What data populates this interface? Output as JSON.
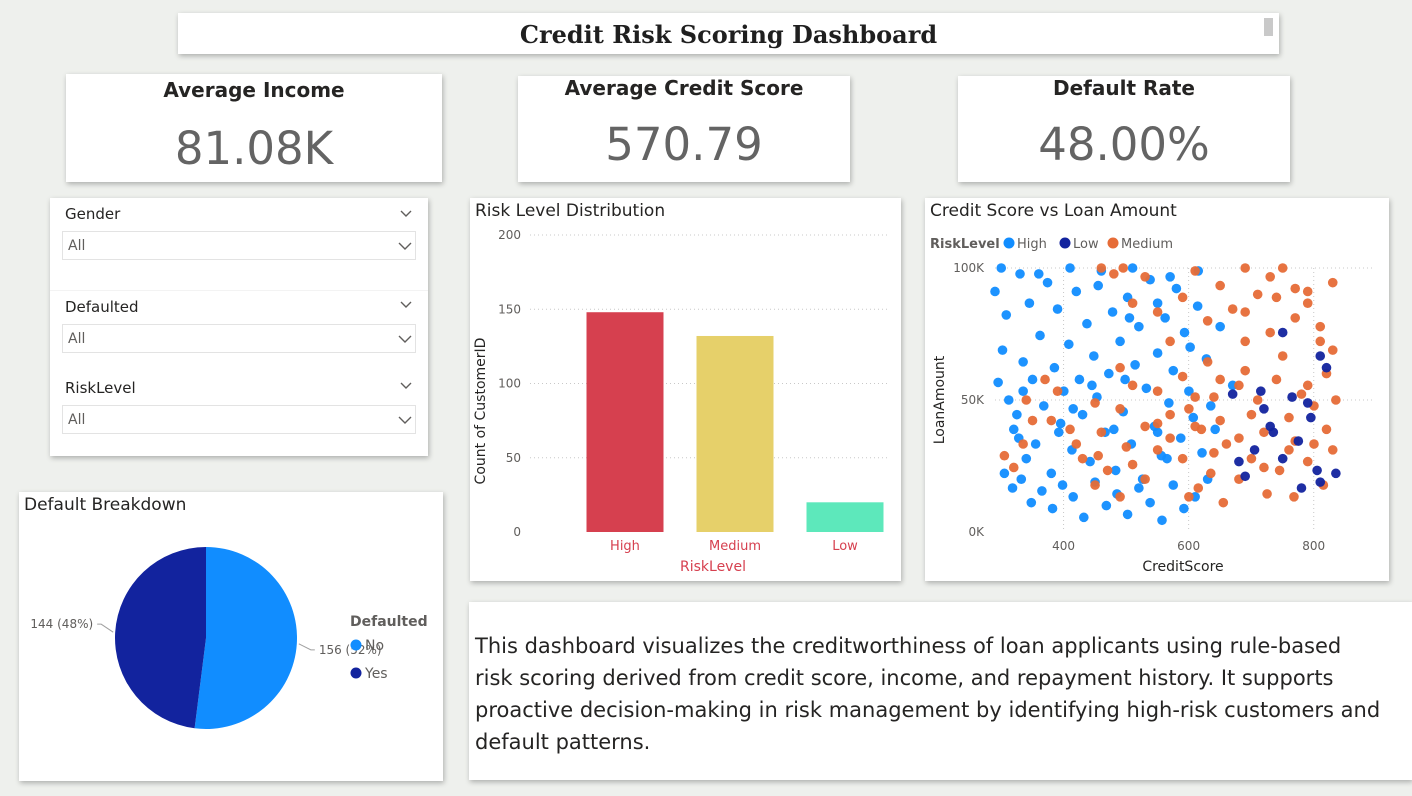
{
  "header": {
    "title": "Credit Risk Scoring Dashboard"
  },
  "kpis": {
    "income": {
      "label": "Average Income",
      "value": "81.08K"
    },
    "credit": {
      "label": "Average Credit Score",
      "value": "570.79"
    },
    "default": {
      "label": "Default Rate",
      "value": "48.00%"
    }
  },
  "slicers": [
    {
      "title": "Gender",
      "value": "All"
    },
    {
      "title": "Defaulted",
      "value": "All"
    },
    {
      "title": "RiskLevel",
      "value": "All"
    }
  ],
  "chart_data": [
    {
      "type": "bar",
      "title": "Risk Level Distribution",
      "xlabel": "RiskLevel",
      "ylabel": "Count of CustomerID",
      "categories": [
        "High",
        "Medium",
        "Low"
      ],
      "values": [
        148,
        132,
        20
      ],
      "colors": [
        "#d6404f",
        "#e6d06a",
        "#5de8bb"
      ],
      "ylim": [
        0,
        200
      ],
      "yticks": [
        0,
        50,
        100,
        150,
        200
      ],
      "grid": true
    },
    {
      "type": "scatter",
      "title": "Credit Score vs Loan Amount",
      "xlabel": "CreditScore",
      "ylabel": "LoanAmount",
      "legend_title": "RiskLevel",
      "legend_position": "top-left",
      "xlim": [
        300,
        850
      ],
      "ylim": [
        10000,
        100000
      ],
      "xticks": [
        400,
        600,
        800
      ],
      "ytick_values": [
        10000,
        55000,
        100000
      ],
      "ytick_labels": [
        "0K",
        "50K",
        "100K"
      ],
      "series": [
        {
          "name": "High",
          "color": "#118dff",
          "points": [
            [
              300,
              92000
            ],
            [
              305,
              61000
            ],
            [
              312,
              72000
            ],
            [
              318,
              84000
            ],
            [
              322,
              55000
            ],
            [
              330,
              45000
            ],
            [
              335,
              50000
            ],
            [
              340,
              98000
            ],
            [
              345,
              68000
            ],
            [
              350,
              35000
            ],
            [
              355,
              88000
            ],
            [
              360,
              62000
            ],
            [
              365,
              40000
            ],
            [
              372,
              77000
            ],
            [
              378,
              53000
            ],
            [
              384,
              95000
            ],
            [
              390,
              30000
            ],
            [
              395,
              66000
            ],
            [
              400,
              86000
            ],
            [
              405,
              47000
            ],
            [
              410,
              58000
            ],
            [
              418,
              74000
            ],
            [
              423,
              38000
            ],
            [
              430,
              92000
            ],
            [
              435,
              62000
            ],
            [
              440,
              50000
            ],
            [
              447,
              81000
            ],
            [
              452,
              34000
            ],
            [
              458,
              70000
            ],
            [
              463,
              56000
            ],
            [
              470,
              99000
            ],
            [
              476,
              44000
            ],
            [
              482,
              64000
            ],
            [
              488,
              85000
            ],
            [
              493,
              31000
            ],
            [
              500,
              75000
            ],
            [
              505,
              51000
            ],
            [
              512,
              90000
            ],
            [
              518,
              40000
            ],
            [
              524,
              67000
            ],
            [
              530,
              80000
            ],
            [
              536,
              28000
            ],
            [
              542,
              59000
            ],
            [
              548,
              96000
            ],
            [
              555,
              46000
            ],
            [
              560,
              71000
            ],
            [
              566,
              36000
            ],
            [
              572,
              83000
            ],
            [
              578,
              54000
            ],
            [
              585,
              65000
            ],
            [
              590,
              93000
            ],
            [
              597,
              42000
            ],
            [
              603,
              78000
            ],
            [
              610,
              58000
            ],
            [
              617,
              49000
            ],
            [
              624,
              87000
            ],
            [
              631,
              37000
            ],
            [
              638,
              69000
            ],
            [
              645,
              53000
            ],
            [
              652,
              45000
            ],
            [
              315,
              30000
            ],
            [
              328,
              25000
            ],
            [
              342,
              28000
            ],
            [
              358,
              20000
            ],
            [
              375,
              24000
            ],
            [
              392,
              18000
            ],
            [
              408,
              26000
            ],
            [
              425,
              22000
            ],
            [
              442,
              15000
            ],
            [
              460,
              27000
            ],
            [
              478,
              19000
            ],
            [
              495,
              23000
            ],
            [
              512,
              16000
            ],
            [
              530,
              25000
            ],
            [
              548,
              20000
            ],
            [
              567,
              14000
            ],
            [
              585,
              26000
            ],
            [
              602,
              18000
            ],
            [
              620,
              22000
            ],
            [
              640,
              28000
            ],
            [
              310,
              100000
            ],
            [
              370,
              98000
            ],
            [
              420,
              100000
            ],
            [
              465,
              94000
            ],
            [
              520,
              100000
            ],
            [
              580,
              97000
            ],
            [
              625,
              99000
            ],
            [
              338,
              42000
            ],
            [
              402,
              44000
            ],
            [
              455,
              60000
            ],
            [
              508,
              62000
            ],
            [
              560,
              44000
            ],
            [
              612,
              73000
            ],
            [
              660,
              80000
            ],
            [
              575,
              35000
            ],
            [
              490,
              45000
            ],
            [
              425,
              52000
            ],
            [
              345,
              58000
            ],
            [
              680,
              60000
            ],
            [
              560,
              88000
            ],
            [
              515,
              83000
            ]
          ]
        },
        {
          "name": "Low",
          "color": "#12239e",
          "points": [
            [
              680,
              57000
            ],
            [
              700,
              29000
            ],
            [
              715,
              38000
            ],
            [
              730,
              52000
            ],
            [
              745,
              44000
            ],
            [
              760,
              35000
            ],
            [
              775,
              56000
            ],
            [
              790,
              25000
            ],
            [
              805,
              49000
            ],
            [
              815,
              31000
            ],
            [
              820,
              70000
            ],
            [
              830,
              66000
            ],
            [
              845,
              30000
            ],
            [
              760,
              78000
            ],
            [
              800,
              54000
            ],
            [
              725,
              58000
            ],
            [
              690,
              34000
            ],
            [
              740,
              46000
            ],
            [
              785,
              41000
            ],
            [
              820,
              27000
            ]
          ]
        },
        {
          "name": "Medium",
          "color": "#e66c37",
          "points": [
            [
              470,
              100000
            ],
            [
              490,
              98000
            ],
            [
              505,
              100000
            ],
            [
              520,
              88000
            ],
            [
              540,
              97000
            ],
            [
              560,
              85000
            ],
            [
              580,
              75000
            ],
            [
              600,
              90000
            ],
            [
              620,
              99000
            ],
            [
              640,
              82000
            ],
            [
              660,
              94000
            ],
            [
              680,
              86000
            ],
            [
              700,
              100000
            ],
            [
              720,
              91000
            ],
            [
              740,
              97000
            ],
            [
              760,
              100000
            ],
            [
              780,
              93000
            ],
            [
              800,
              88000
            ],
            [
              820,
              80000
            ],
            [
              840,
              95000
            ],
            [
              610,
              52000
            ],
            [
              630,
              45000
            ],
            [
              650,
              56000
            ],
            [
              670,
              40000
            ],
            [
              690,
              60000
            ],
            [
              710,
              50000
            ],
            [
              730,
              44000
            ],
            [
              750,
              62000
            ],
            [
              770,
              49000
            ],
            [
              790,
              57000
            ],
            [
              810,
              53000
            ],
            [
              830,
              64000
            ],
            [
              845,
              55000
            ],
            [
              600,
              35000
            ],
            [
              625,
              25000
            ],
            [
              645,
              30000
            ],
            [
              665,
              20000
            ],
            [
              690,
              28000
            ],
            [
              710,
              35000
            ],
            [
              735,
              23000
            ],
            [
              755,
              31000
            ],
            [
              778,
              22000
            ],
            [
              800,
              34000
            ],
            [
              825,
              26000
            ],
            [
              840,
              38000
            ],
            [
              560,
              38000
            ],
            [
              540,
              28000
            ],
            [
              520,
              33000
            ],
            [
              500,
              22000
            ],
            [
              480,
              31000
            ],
            [
              460,
              26000
            ],
            [
              440,
              35000
            ],
            [
              420,
              45000
            ],
            [
              400,
              58000
            ],
            [
              380,
              62000
            ],
            [
              360,
              48000
            ],
            [
              345,
              40000
            ],
            [
              330,
              32000
            ],
            [
              315,
              36000
            ],
            [
              560,
              58000
            ],
            [
              520,
              60000
            ],
            [
              460,
              54000
            ],
            [
              580,
              50000
            ],
            [
              640,
              68000
            ],
            [
              700,
              75000
            ],
            [
              760,
              70000
            ],
            [
              800,
              60000
            ],
            [
              820,
              75000
            ],
            [
              780,
              83000
            ],
            [
              740,
              78000
            ],
            [
              700,
              65000
            ],
            [
              660,
              62000
            ],
            [
              620,
              56000
            ],
            [
              580,
              42000
            ],
            [
              540,
              46000
            ],
            [
              500,
              52000
            ],
            [
              430,
              40000
            ],
            [
              465,
              36000
            ],
            [
              500,
              66000
            ],
            [
              560,
              47000
            ],
            [
              600,
              63000
            ],
            [
              660,
              48000
            ],
            [
              720,
              55000
            ],
            [
              780,
              41000
            ],
            [
              830,
              45000
            ],
            [
              610,
              22000
            ],
            [
              650,
              37000
            ],
            [
              690,
              42000
            ],
            [
              730,
              32000
            ],
            [
              770,
              38000
            ],
            [
              810,
              40000
            ],
            [
              700,
              85000
            ],
            [
              750,
              90000
            ],
            [
              800,
              92000
            ],
            [
              840,
              72000
            ],
            [
              510,
              39000
            ],
            [
              470,
              44000
            ],
            [
              390,
              48000
            ],
            [
              350,
              55000
            ],
            [
              620,
              46000
            ]
          ]
        }
      ]
    },
    {
      "type": "pie",
      "title": "Default Breakdown",
      "legend_title": "Defaulted",
      "legend_position": "right",
      "slices": [
        {
          "label": "No",
          "value": 156,
          "percent": 52,
          "color": "#118dff",
          "data_label": "156 (52%)"
        },
        {
          "label": "Yes",
          "value": 144,
          "percent": 48,
          "color": "#12239e",
          "data_label": "144 (48%)"
        }
      ]
    }
  ],
  "description": "This dashboard visualizes the creditworthiness of loan applicants using rule-based risk scoring derived from credit score, income, and repayment history. It supports proactive decision-making in risk management by identifying high-risk customers and default patterns.",
  "icons": {
    "slicer_header": "chevron-down-icon",
    "dropdown": "chevron-down-icon"
  }
}
